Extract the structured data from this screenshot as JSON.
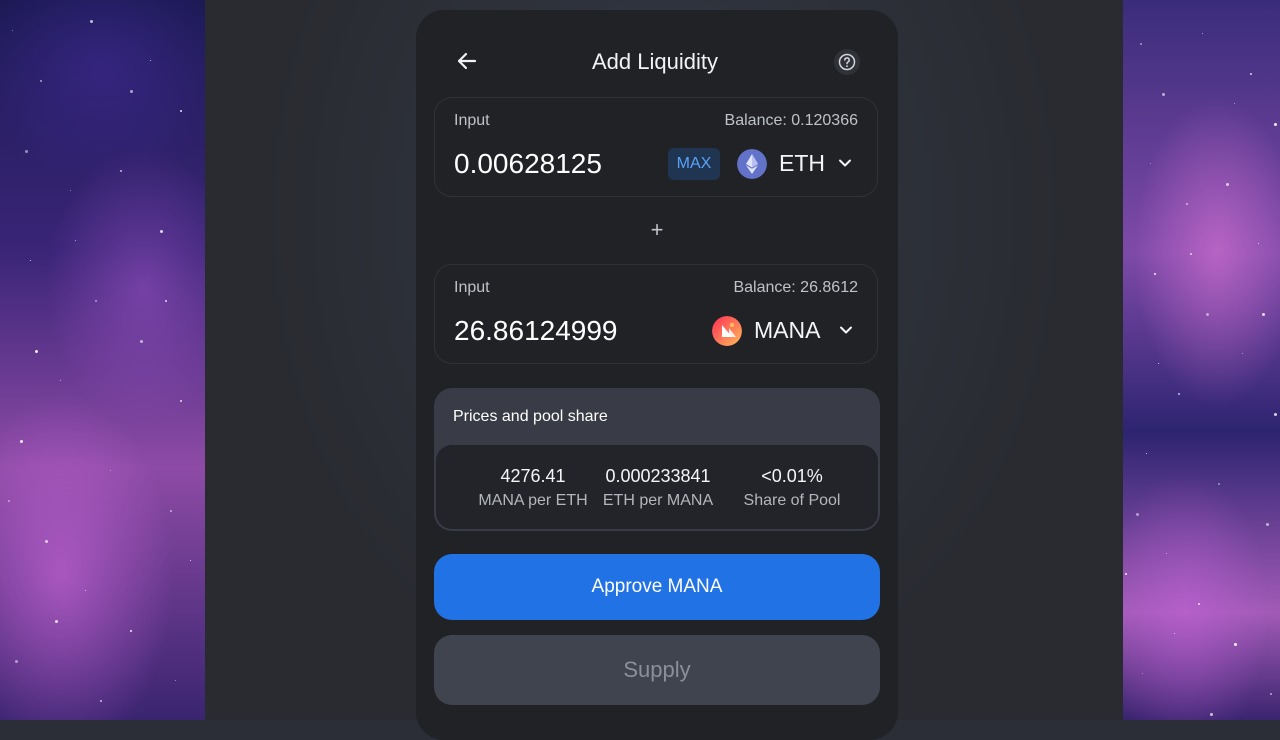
{
  "header": {
    "title": "Add Liquidity",
    "back_icon": "arrow-left-icon",
    "help_icon": "question-circle-icon"
  },
  "input_a": {
    "label": "Input",
    "balance": "Balance: 0.120366",
    "amount": "0.00628125",
    "max_label": "MAX",
    "token": "ETH",
    "token_icon": "eth-icon"
  },
  "separator": "+",
  "input_b": {
    "label": "Input",
    "balance": "Balance: 26.8612",
    "amount": "26.86124999",
    "token": "MANA",
    "token_icon": "mana-icon"
  },
  "pool": {
    "title": "Prices and pool share",
    "stats": [
      {
        "value": "4276.41",
        "label": "MANA per ETH"
      },
      {
        "value": "0.000233841",
        "label": "ETH per MANA"
      },
      {
        "value": "<0.01%",
        "label": "Share of Pool"
      }
    ]
  },
  "actions": {
    "approve_label": "Approve MANA",
    "supply_label": "Supply"
  },
  "colors": {
    "accent": "#2172e5",
    "panel": "#202226",
    "max_text": "#5aa2f6"
  }
}
